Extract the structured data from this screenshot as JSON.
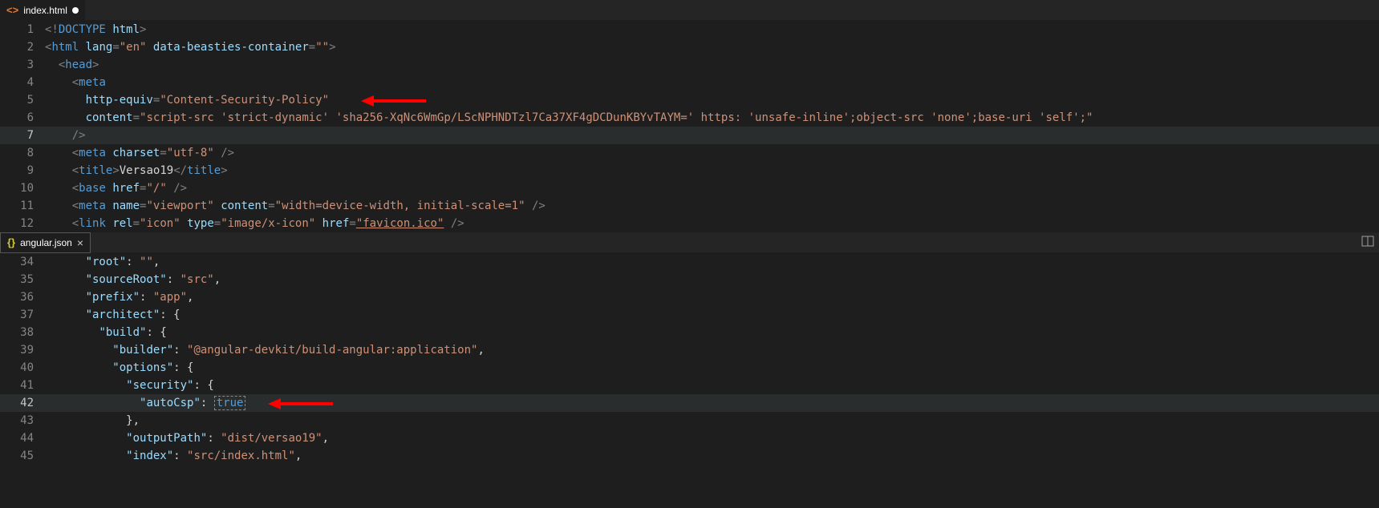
{
  "pane1": {
    "tab": {
      "icon": "<>",
      "label": "index.html",
      "dirty": true
    },
    "lines": {
      "l1": {
        "n": "1"
      },
      "l2": {
        "n": "2"
      },
      "l3": {
        "n": "3"
      },
      "l4": {
        "n": "4"
      },
      "l5": {
        "n": "5"
      },
      "l6": {
        "n": "6"
      },
      "l7": {
        "n": "7"
      },
      "l8": {
        "n": "8"
      },
      "l9": {
        "n": "9"
      },
      "l10": {
        "n": "10"
      },
      "l11": {
        "n": "11"
      },
      "l12": {
        "n": "12"
      }
    },
    "code": {
      "doctype": "<!DOCTYPE ",
      "doctype_html": "html",
      "doctype_close": ">",
      "html_open": "<",
      "html_tag": "html",
      "lang_attr": "lang",
      "lang_val": "\"en\"",
      "beasties_attr": "data-beasties-container",
      "beasties_val": "\"\"",
      "gt": ">",
      "head_open": "<",
      "head_tag": "head",
      "meta_open": "<",
      "meta_tag": "meta",
      "httpequiv_attr": "http-equiv",
      "httpequiv_val": "\"Content-Security-Policy\"",
      "content_attr": "content",
      "content_val": "\"script-src 'strict-dynamic' 'sha256-XqNc6WmGp/LScNPHNDTzl7Ca37XF4gDCDunKBYvTAYM=' https: 'unsafe-inline';object-src 'none';base-uri 'self';\"",
      "selfclose": "/>",
      "charset_attr": "charset",
      "charset_val": "\"utf-8\"",
      "title_open": "<",
      "title_tag": "title",
      "title_text": "Versao19",
      "title_close_open": "</",
      "base_tag": "base",
      "href_attr": "href",
      "href_val": "\"/\"",
      "name_attr": "name",
      "viewport_val": "\"viewport\"",
      "viewport_content": "\"width=device-width, initial-scale=1\"",
      "link_tag": "link",
      "rel_attr": "rel",
      "rel_val": "\"icon\"",
      "type_attr": "type",
      "type_val": "\"image/x-icon\"",
      "favicon_val": "\"favicon.ico\""
    }
  },
  "pane2": {
    "tab": {
      "icon": "{}",
      "label": "angular.json"
    },
    "lines": {
      "l34": {
        "n": "34"
      },
      "l35": {
        "n": "35"
      },
      "l36": {
        "n": "36"
      },
      "l37": {
        "n": "37"
      },
      "l38": {
        "n": "38"
      },
      "l39": {
        "n": "39"
      },
      "l40": {
        "n": "40"
      },
      "l41": {
        "n": "41"
      },
      "l42": {
        "n": "42"
      },
      "l43": {
        "n": "43"
      },
      "l44": {
        "n": "44"
      },
      "l45": {
        "n": "45"
      }
    },
    "code": {
      "root_key": "\"root\"",
      "root_val": "\"\"",
      "sourceRoot_key": "\"sourceRoot\"",
      "sourceRoot_val": "\"src\"",
      "prefix_key": "\"prefix\"",
      "prefix_val": "\"app\"",
      "architect_key": "\"architect\"",
      "build_key": "\"build\"",
      "builder_key": "\"builder\"",
      "builder_val": "\"@angular-devkit/build-angular:application\"",
      "options_key": "\"options\"",
      "security_key": "\"security\"",
      "autoCsp_key": "\"autoCsp\"",
      "autoCsp_val": "true",
      "outputPath_key": "\"outputPath\"",
      "outputPath_val": "\"dist/versao19\"",
      "index_key": "\"index\"",
      "index_val": "\"src/index.html\"",
      "colon": ": ",
      "comma": ",",
      "lbrace": "{",
      "rbrace": "}"
    }
  }
}
